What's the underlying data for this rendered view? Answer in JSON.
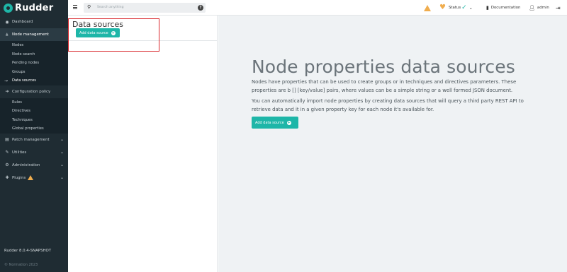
{
  "sidebar": {
    "brand": "Rudder",
    "items": [
      {
        "label": "Dashboard"
      },
      {
        "label": "Node management"
      },
      {
        "label": "Configuration policy"
      },
      {
        "label": "Patch management"
      },
      {
        "label": "Utilities"
      },
      {
        "label": "Administration"
      },
      {
        "label": "Plugins"
      }
    ],
    "node_subitems": [
      "Nodes",
      "Node search",
      "Pending nodes",
      "Groups",
      "Data sources"
    ],
    "policy_subitems": [
      "Rules",
      "Directives",
      "Techniques",
      "Global properties"
    ],
    "version": "Rudder 8.0.4-SNAPSHOT",
    "copyright": "© Normation 2023"
  },
  "topbar": {
    "search_placeholder": "Search anything",
    "help": "?",
    "status_label": "Status",
    "documentation_label": "Documentation",
    "user_label": "admin"
  },
  "list_panel": {
    "title": "Data sources",
    "add_button": "Add data source"
  },
  "main": {
    "title": "Node properties data sources",
    "paragraph1": "Nodes have properties that can be used to create groups or in techniques and directives parameters. These properties are b [] [key/value] pairs, where values can be a simple string or a well formed JSON document.",
    "paragraph2": "You can automatically import node properties by creating data sources that will query a third party REST API to retrieve data and it in a given property key for each node it's available for.",
    "add_button": "Add data source"
  },
  "colors": {
    "accent": "#1eb6a8",
    "sidebar_bg": "#1f2c33",
    "warning": "#f0ad4e",
    "highlight_box": "#d9262b"
  }
}
